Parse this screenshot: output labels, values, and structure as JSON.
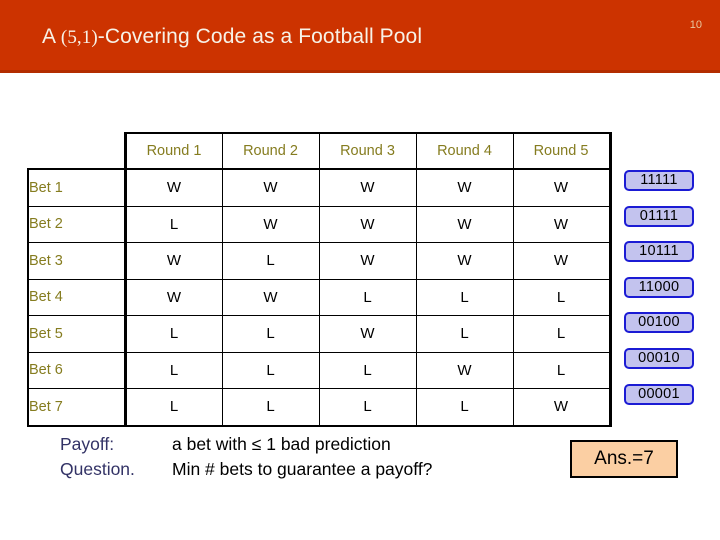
{
  "header": {
    "title_prefix": "A ",
    "title_paren": "(5,1)",
    "title_suffix": "-Covering Code as a Football Pool",
    "slide_number": "10",
    "banner_color": "#cc3300",
    "title_color": "#f7f2e7"
  },
  "table": {
    "corner_label": "",
    "column_headers": [
      "Round 1",
      "Round 2",
      "Round 3",
      "Round 4",
      "Round 5"
    ],
    "header_color": "#857c1f",
    "bet_label_color": "#857c1f",
    "rows": [
      {
        "label": "Bet 1",
        "results": [
          "W",
          "W",
          "W",
          "W",
          "W"
        ],
        "code": "11111"
      },
      {
        "label": "Bet 2",
        "results": [
          "L",
          "W",
          "W",
          "W",
          "W"
        ],
        "code": "01111"
      },
      {
        "label": "Bet 3",
        "results": [
          "W",
          "L",
          "W",
          "W",
          "W"
        ],
        "code": "10111"
      },
      {
        "label": "Bet 4",
        "results": [
          "W",
          "W",
          "L",
          "L",
          "L"
        ],
        "code": "11000"
      },
      {
        "label": "Bet 5",
        "results": [
          "L",
          "L",
          "W",
          "L",
          "L"
        ],
        "code": "00100"
      },
      {
        "label": "Bet 6",
        "results": [
          "L",
          "L",
          "L",
          "W",
          "L"
        ],
        "code": "00010"
      },
      {
        "label": "Bet 7",
        "results": [
          "L",
          "L",
          "L",
          "L",
          "W"
        ],
        "code": "00001"
      }
    ],
    "badge_fill": "#c3c3ee",
    "badge_border": "#1b1bd4"
  },
  "notes": {
    "payoff_label": "Payoff:",
    "payoff_text": "a bet with ≤ 1 bad prediction",
    "question_label": "Question.",
    "question_text": "Min # bets to guarantee a payoff?",
    "label_color": "#333366"
  },
  "answer": {
    "text": "Ans.=7",
    "fill": "#fbcfa3",
    "border": "#000000"
  }
}
